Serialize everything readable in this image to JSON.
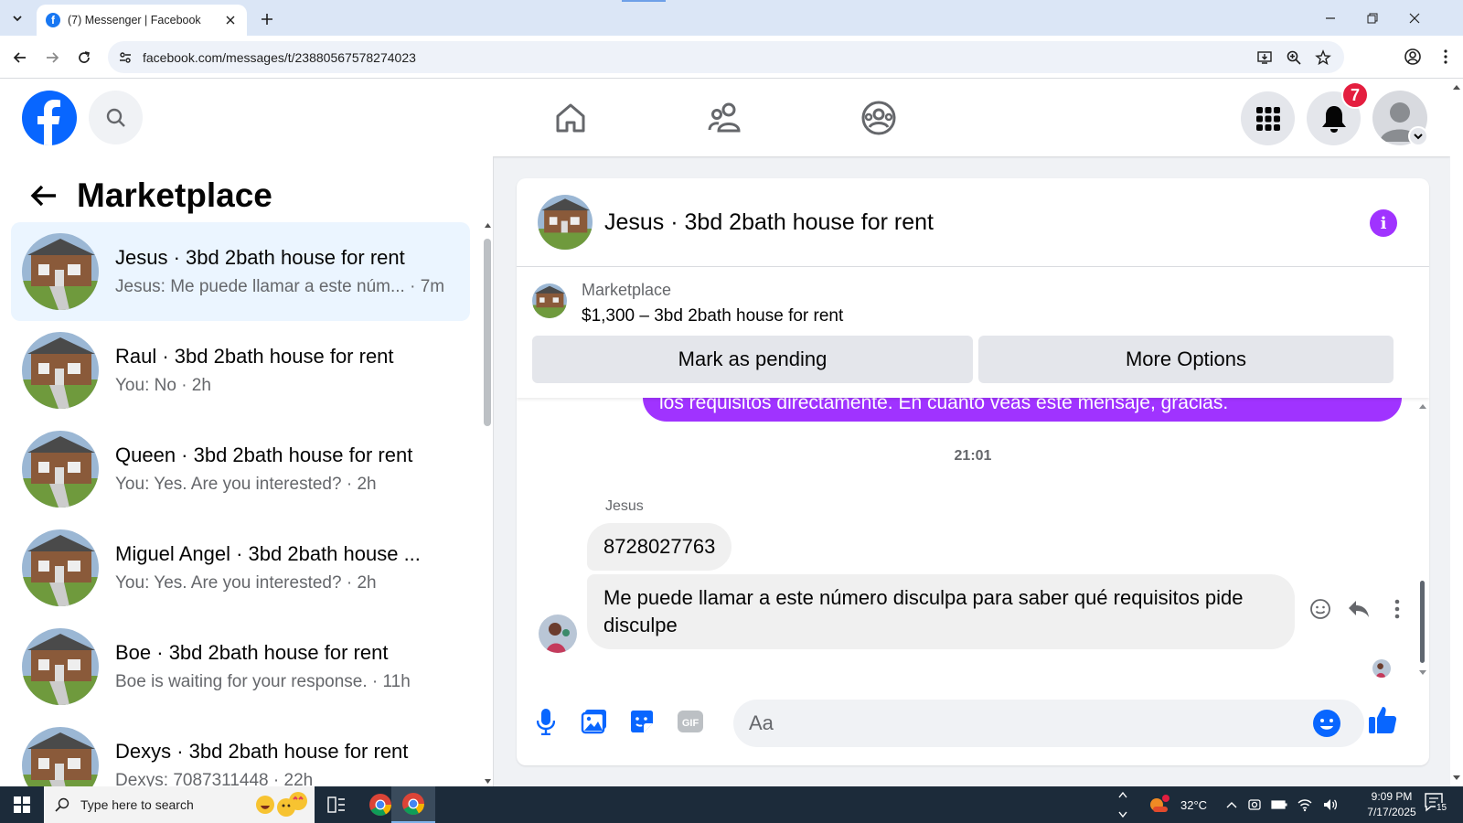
{
  "browser": {
    "tab_title": "(7) Messenger | Facebook",
    "url": "facebook.com/messages/t/23880567578274023"
  },
  "header": {
    "notification_count": "7"
  },
  "sidebar": {
    "title": "Marketplace",
    "conversations": [
      {
        "name": "Jesus · 3bd 2bath house for rent",
        "preview": "Jesus: Me puede llamar a este núm...",
        "time": "· 7m",
        "active": true
      },
      {
        "name": "Raul · 3bd 2bath house for rent",
        "preview": "You: No",
        "time": "· 2h"
      },
      {
        "name": "Queen · 3bd 2bath house for rent",
        "preview": "You: Yes. Are you interested?",
        "time": "· 2h"
      },
      {
        "name": "Miguel Angel · 3bd 2bath house ...",
        "preview": "You: Yes. Are you interested?",
        "time": "· 2h"
      },
      {
        "name": "Boe · 3bd 2bath house for rent",
        "preview": "Boe is waiting for your response.",
        "time": "· 11h"
      },
      {
        "name": "Dexys · 3bd 2bath house for rent",
        "preview": "Dexys: 7087311448",
        "time": "· 22h"
      }
    ]
  },
  "chat": {
    "title": "Jesus · 3bd 2bath house for rent",
    "marketplace_label": "Marketplace",
    "listing": "$1,300 – 3bd 2bath house for rent",
    "mark_pending_label": "Mark as pending",
    "more_options_label": "More Options",
    "sent_partial": "los requisitos directamente. En cuanto veas este mensaje, gracias.",
    "timestamp": "21:01",
    "sender": "Jesus",
    "messages": [
      "8728027763",
      "Me puede llamar a este número disculpa para saber qué requisitos pide disculpe"
    ],
    "composer_placeholder": "Aa",
    "accent_color": "#a033ff"
  },
  "taskbar": {
    "search_placeholder": "Type here to search",
    "weather": "32°C",
    "time": "9:09 PM",
    "date": "7/17/2025",
    "notification_count": "15"
  }
}
